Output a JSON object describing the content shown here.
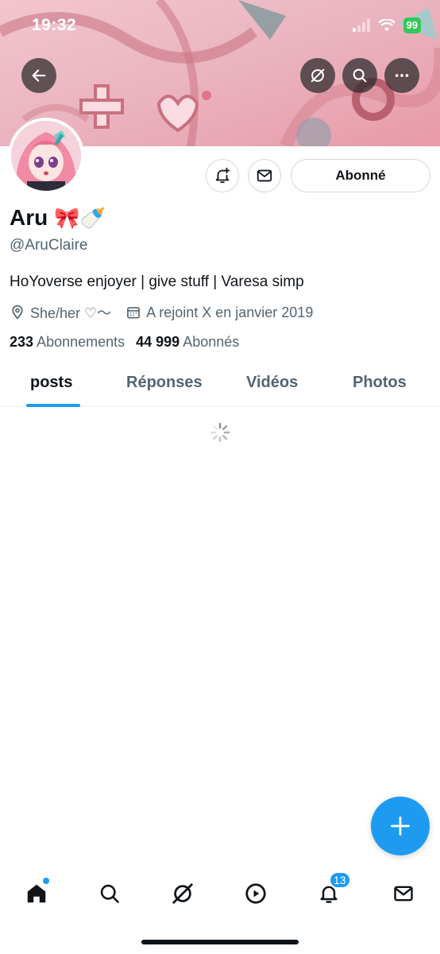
{
  "status_bar": {
    "time": "19:32",
    "battery": "99"
  },
  "header": {
    "back_icon": "arrow-left-icon",
    "grok_icon": "grok-icon",
    "search_icon": "search-icon",
    "more_icon": "more-dots-icon"
  },
  "profile": {
    "name": "Aru",
    "name_emoji": "🎀🍼",
    "handle": "@AruClaire",
    "bio": "HoYoverse enjoyer | give stuff | Varesa simp",
    "location": "She/her ♡〜",
    "joined": "A rejoint X en janvier 2019",
    "following_count": "233",
    "following_label": "Abonnements",
    "followers_count": "44 999",
    "followers_label": "Abonnés",
    "follow_button": "Abonné"
  },
  "tabs": [
    {
      "label": "posts",
      "active": true
    },
    {
      "label": "Réponses",
      "active": false
    },
    {
      "label": "Vidéos",
      "active": false
    },
    {
      "label": "Photos",
      "active": false
    }
  ],
  "bottom_nav": {
    "notifications_badge": "13"
  },
  "colors": {
    "accent": "#1d9bf0",
    "text_primary": "#0f1419",
    "text_secondary": "#536471"
  }
}
